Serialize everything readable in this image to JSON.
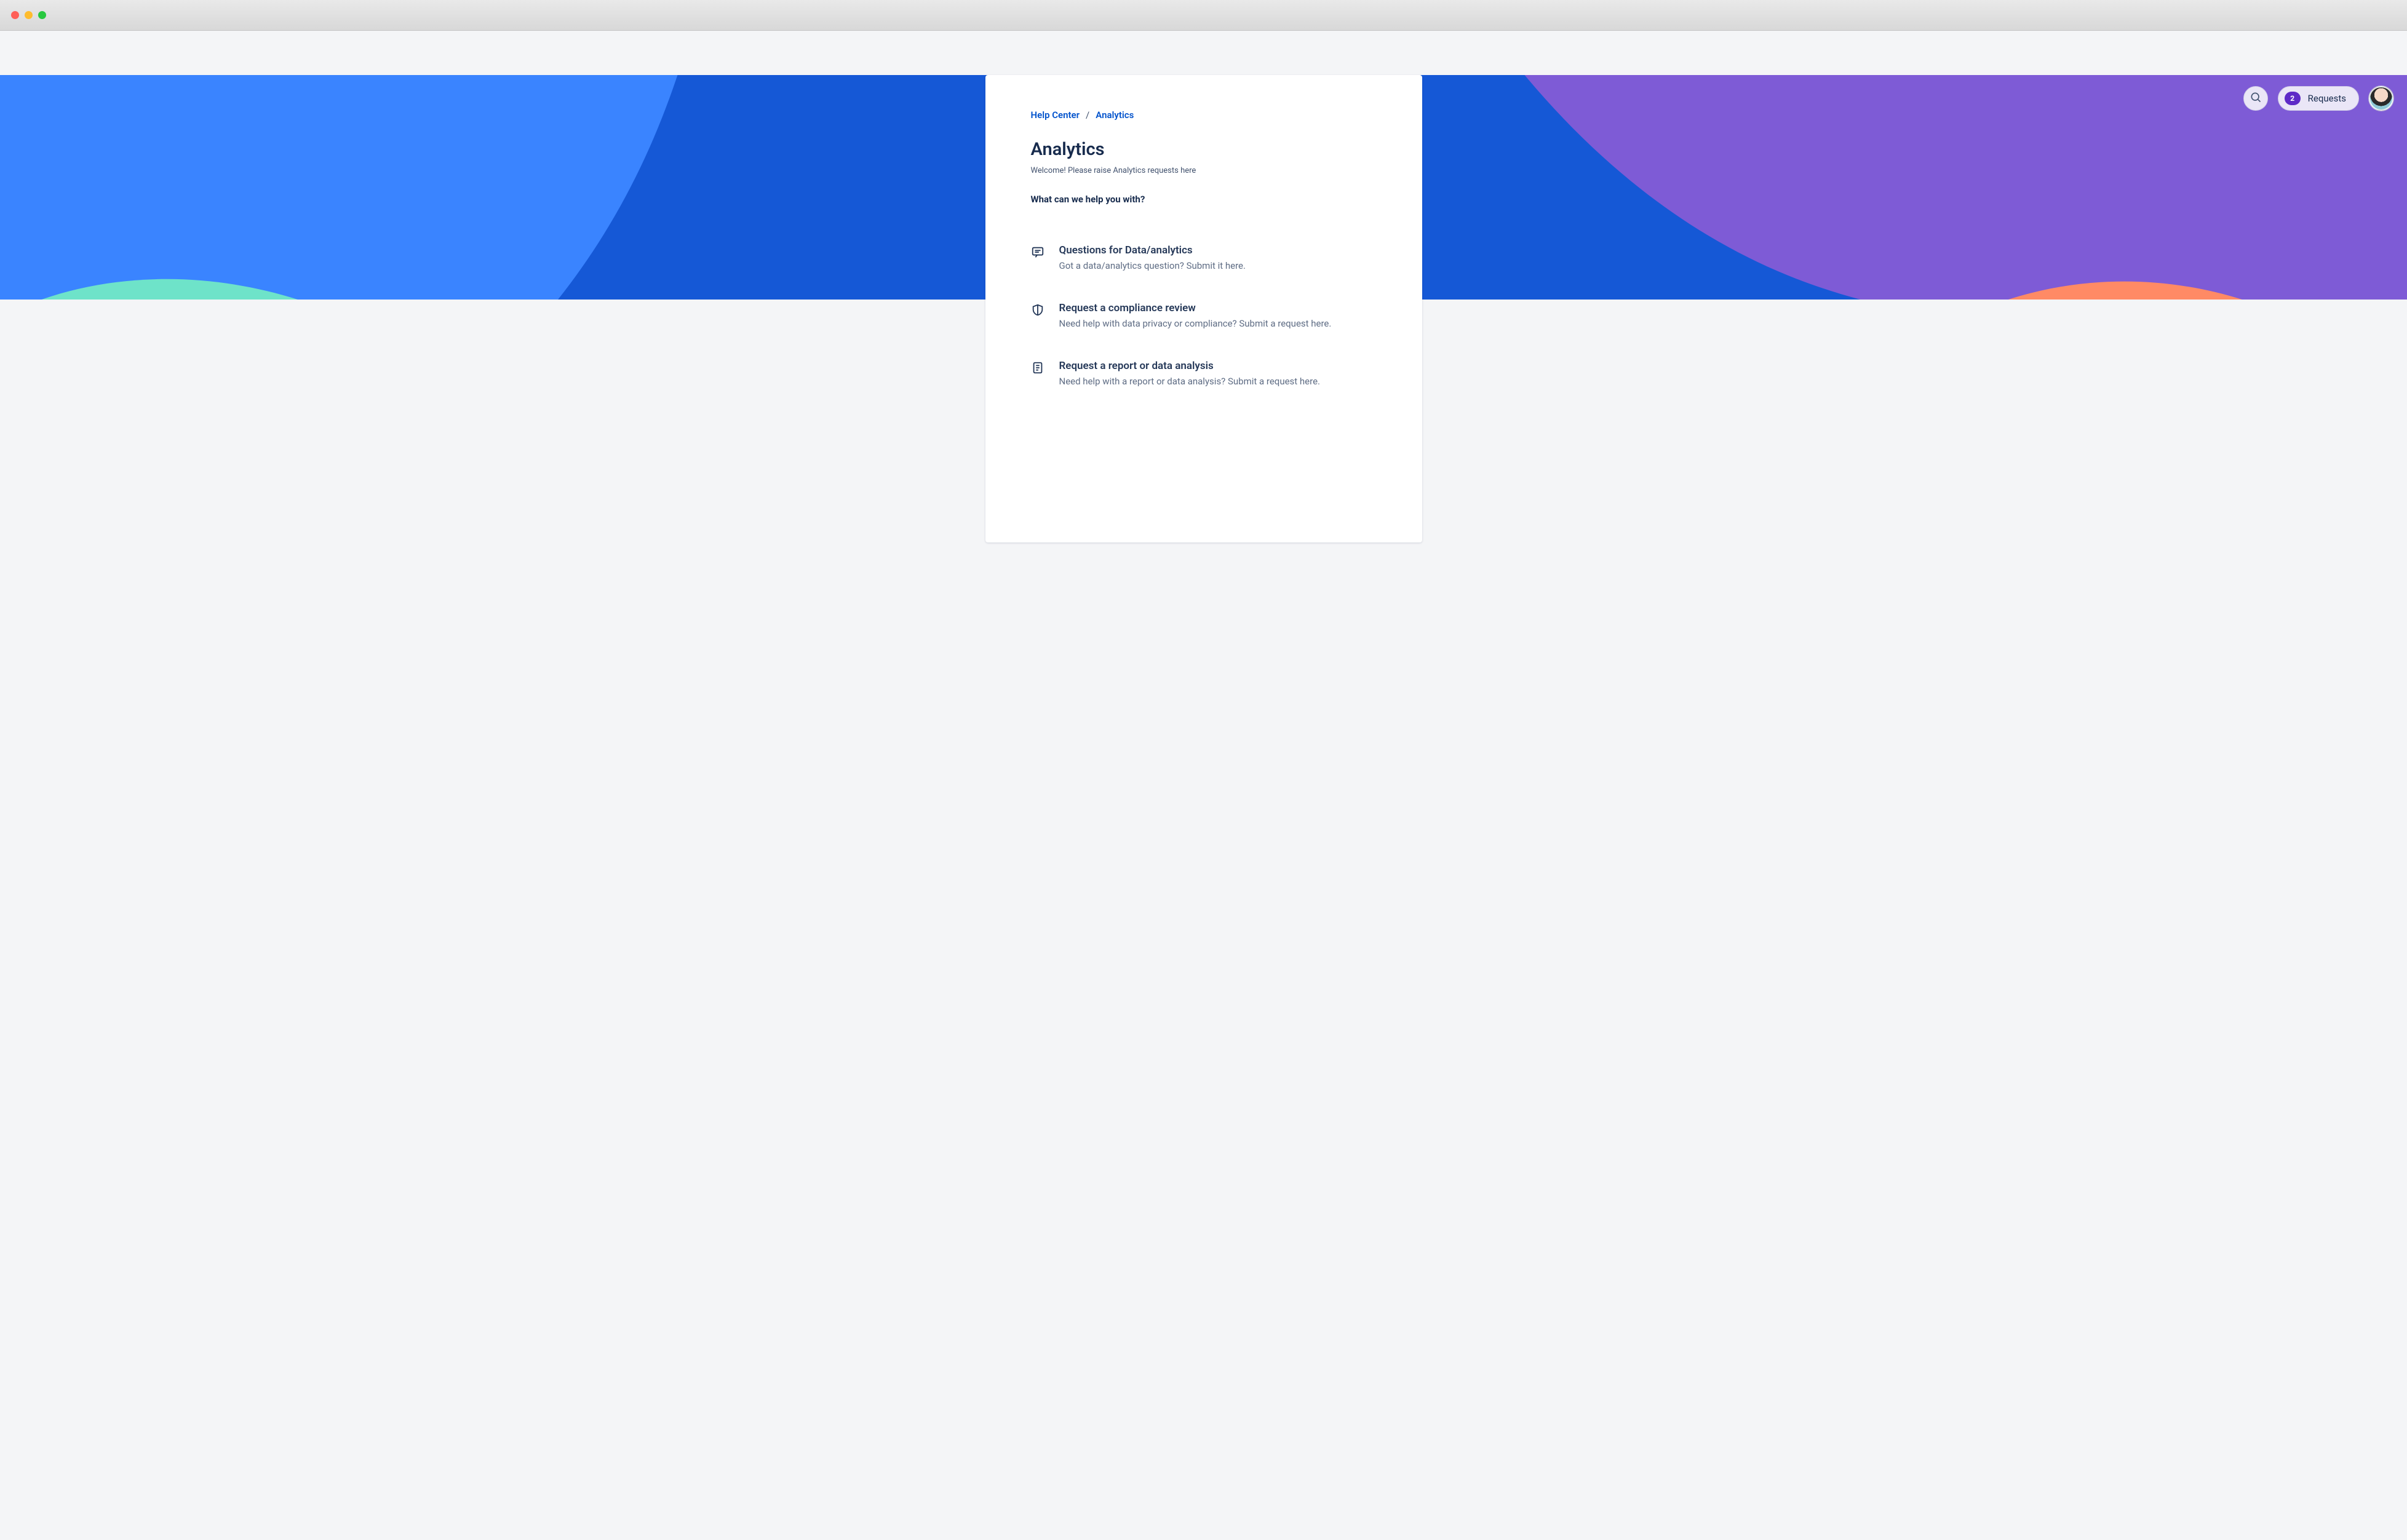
{
  "breadcrumb": {
    "root": "Help Center",
    "current": "Analytics"
  },
  "page": {
    "title": "Analytics",
    "subtitle": "Welcome! Please raise Analytics requests here",
    "prompt": "What can we help you with?"
  },
  "requests_button": {
    "count": "2",
    "label": "Requests"
  },
  "options": [
    {
      "icon": "chat-icon",
      "title": "Questions for Data/analytics",
      "desc": "Got a data/analytics question? Submit it here."
    },
    {
      "icon": "shield-icon",
      "title": "Request a compliance review",
      "desc": "Need help with data privacy or compliance? Submit a request here."
    },
    {
      "icon": "document-icon",
      "title": "Request a report or data analysis",
      "desc": "Need help with a report or data analysis? Submit a request here."
    }
  ]
}
